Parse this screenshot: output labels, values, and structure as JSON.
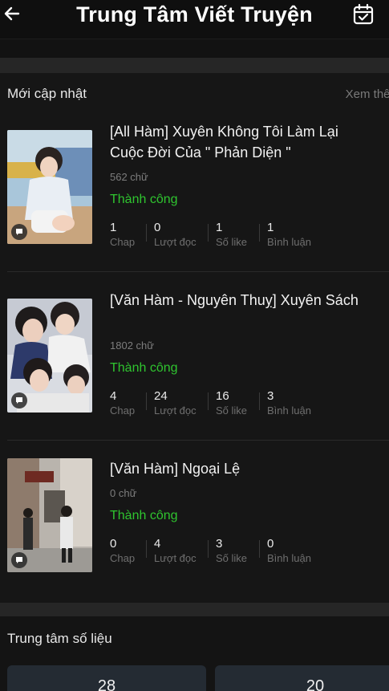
{
  "header": {
    "title": "Trung Tâm Viết Truyện",
    "back_icon": "arrow-left-icon",
    "calendar_icon": "calendar-check-icon"
  },
  "recent": {
    "title": "Mới cập nhật",
    "see_more": "Xem thêm",
    "stat_labels": [
      "Chap",
      "Lượt đọc",
      "Số like",
      "Bình luận"
    ],
    "stories": [
      {
        "title": "[All Hàm] Xuyên Không Tôi Làm Lại Cuộc Đời Của \" Phản Diện \"",
        "words": "562 chữ",
        "status": "Thành công",
        "stats": [
          "1",
          "0",
          "1",
          "1"
        ]
      },
      {
        "title": "[Văn Hàm - Nguyên Thuỵ] Xuyên Sách",
        "words": "1802 chữ",
        "status": "Thành công",
        "stats": [
          "4",
          "24",
          "16",
          "3"
        ]
      },
      {
        "title": "[Văn Hàm] Ngoại Lệ",
        "words": "0 chữ",
        "status": "Thành công",
        "stats": [
          "0",
          "4",
          "3",
          "0"
        ]
      }
    ]
  },
  "data_center": {
    "title": "Trung tâm số liệu",
    "cards": [
      "28",
      "20"
    ]
  },
  "colors": {
    "background": "#121212",
    "success": "#2fc52f",
    "muted": "#7d7d7d"
  }
}
